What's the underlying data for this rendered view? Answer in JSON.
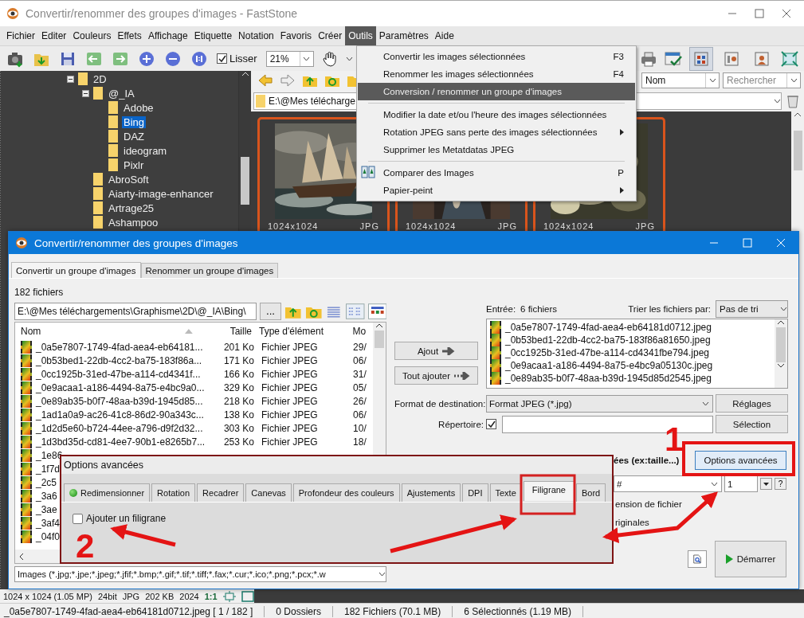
{
  "window": {
    "title": "Convertir/renommer des groupes d'images - FastStone"
  },
  "menubar": [
    {
      "label": "Fichier",
      "selected": false
    },
    {
      "label": "Editer",
      "selected": false
    },
    {
      "label": "Couleurs",
      "selected": false
    },
    {
      "label": "Effets",
      "selected": false
    },
    {
      "label": "Affichage",
      "selected": false
    },
    {
      "label": "Etiquette",
      "selected": false
    },
    {
      "label": "Notation",
      "selected": false
    },
    {
      "label": "Favoris",
      "selected": false
    },
    {
      "label": "Créer",
      "selected": false
    },
    {
      "label": "Outils",
      "selected": true
    },
    {
      "label": "Paramètres",
      "selected": false
    },
    {
      "label": "Aide",
      "selected": false
    }
  ],
  "toolbar": {
    "smooth": {
      "label": "Lisser",
      "checked": true
    },
    "zoom": "21%",
    "view_buttons": [
      {
        "selected": true
      },
      {
        "selected": false
      },
      {
        "selected": false
      }
    ]
  },
  "browser": {
    "sort": "Nom",
    "search_placeholder": "Rechercher",
    "path": "E:\\@Mes télécharge"
  },
  "tree": [
    {
      "label": "2D",
      "selected": false,
      "children": [
        {
          "label": "@_IA",
          "selected": false,
          "children": [
            {
              "label": "Adobe",
              "selected": false
            },
            {
              "label": "Bing",
              "selected": true
            },
            {
              "label": "DAZ",
              "selected": false
            },
            {
              "label": "ideogram",
              "selected": false
            },
            {
              "label": "Pixlr",
              "selected": false
            }
          ]
        },
        {
          "label": "AbroSoft",
          "selected": false
        },
        {
          "label": "Aiarty-image-enhancer",
          "selected": false
        },
        {
          "label": "Artrage25",
          "selected": false
        },
        {
          "label": "Ashampoo",
          "selected": false
        }
      ]
    }
  ],
  "thumbnails": [
    {
      "size": "1024x1024",
      "format": "JPG"
    },
    {
      "size": "1024x1024",
      "format": "JPG"
    },
    {
      "size": "1024x1024",
      "format": "JPG"
    }
  ],
  "tools_menu": [
    {
      "kind": "item",
      "label": "Convertir les images sélectionnées",
      "shortcut": "F3",
      "submenu": false,
      "selected": false
    },
    {
      "kind": "item",
      "label": "Renommer les images sélectionnées",
      "shortcut": "F4",
      "submenu": false,
      "selected": false
    },
    {
      "kind": "item",
      "label": "Conversion / renommer un groupe d'images",
      "submenu": false,
      "selected": true
    },
    {
      "kind": "separator"
    },
    {
      "kind": "item",
      "label": "Modifier la date et/ou l'heure des images sélectionnées",
      "submenu": false,
      "selected": false
    },
    {
      "kind": "item",
      "label": "Rotation JPEG sans perte des images sélectionnées",
      "submenu": true,
      "selected": false
    },
    {
      "kind": "item",
      "label": "Supprimer les Metatdatas JPEG",
      "submenu": false,
      "selected": false
    },
    {
      "kind": "separator"
    },
    {
      "kind": "item",
      "label": "Comparer des Images",
      "shortcut": "P",
      "icon": true,
      "submenu": false,
      "selected": false
    },
    {
      "kind": "item",
      "label": "Papier-peint",
      "submenu": true,
      "selected": false
    }
  ],
  "image_info": {
    "dimensions": "1024 x 1024 (1.05 MP)",
    "depth": "24bit",
    "format": "JPG",
    "size": "202 KB",
    "date": "2024",
    "zoom": "1:1"
  },
  "status_bar": [
    "_0a5e7807-1749-4fad-aea4-eb64181d0712.jpeg [ 1 / 182 ]",
    "0 Dossiers",
    "182 Fichiers (70.1 MB)",
    "6 Sélectionnés (1.19 MB)"
  ],
  "dialog": {
    "title": "Convertir/renommer des groupes d'images",
    "tabs": [
      {
        "label": "Convertir un groupe d'images",
        "selected": true
      },
      {
        "label": "Renommer un groupe d'images",
        "selected": false
      }
    ],
    "file_count": "182 fichiers",
    "folder": "E:\\@Mes téléchargements\\Graphisme\\2D\\@_IA\\Bing\\",
    "browse": "...",
    "columns": [
      "Nom",
      "Taille",
      "Type d'élément",
      "Mo"
    ],
    "files": [
      {
        "name": "_0a5e7807-1749-4fad-aea4-eb64181...",
        "size": "201 Ko",
        "type": "Fichier JPEG",
        "date": "29/"
      },
      {
        "name": "_0b53bed1-22db-4cc2-ba75-183f86a...",
        "size": "171 Ko",
        "type": "Fichier JPEG",
        "date": "06/"
      },
      {
        "name": "_0cc1925b-31ed-47be-a114-cd4341f...",
        "size": "166 Ko",
        "type": "Fichier JPEG",
        "date": "31/"
      },
      {
        "name": "_0e9acaa1-a186-4494-8a75-e4bc9a0...",
        "size": "329 Ko",
        "type": "Fichier JPEG",
        "date": "05/"
      },
      {
        "name": "_0e89ab35-b0f7-48aa-b39d-1945d85...",
        "size": "218 Ko",
        "type": "Fichier JPEG",
        "date": "26/"
      },
      {
        "name": "_1ad1a0a9-ac26-41c8-86d2-90a343c...",
        "size": "138 Ko",
        "type": "Fichier JPEG",
        "date": "06/"
      },
      {
        "name": "_1d2d5e60-b724-44ee-a796-d9f2d32...",
        "size": "303 Ko",
        "type": "Fichier JPEG",
        "date": "10/"
      },
      {
        "name": "_1d3bd35d-cd81-4ee7-90b1-e8265b7...",
        "size": "253 Ko",
        "type": "Fichier JPEG",
        "date": "18/"
      },
      {
        "name": "_1e86"
      },
      {
        "name": "_1f7d"
      },
      {
        "name": "_2c5"
      },
      {
        "name": "_3a6"
      },
      {
        "name": "_3ae"
      },
      {
        "name": "_3af4"
      },
      {
        "name": "_04f0"
      }
    ],
    "filter": "Images (*.jpg;*.jpe;*.jpeg;*.jfif;*.bmp;*.gif;*.tif;*.tiff;*.fax;*.cur;*.ico;*.png;*.pcx;*.w",
    "input_label": "Entrée:",
    "input_count": "6 fichiers",
    "sort_label": "Trier les fichiers par:",
    "sort_value": "Pas de tri",
    "input_files": [
      "_0a5e7807-1749-4fad-aea4-eb64181d0712.jpeg",
      "_0b53bed1-22db-4cc2-ba75-183f86a81650.jpeg",
      "_0cc1925b-31ed-47be-a114-cd4341fbe794.jpeg",
      "_0e9acaa1-a186-4494-8a75-e4bc9a05130c.jpeg",
      "_0e89ab35-b0f7-48aa-b39d-1945d85d2545.jpeg"
    ],
    "add_button": "Ajout",
    "add_all_button": "Tout ajouter",
    "format_label": "Format de destination:",
    "format_value": "Format JPEG (*.jpg)",
    "settings_button": "Réglages",
    "folder_label": "Répertoire:",
    "folder_checked": true,
    "select_button": "Sélection",
    "options_label": "ées (ex:taille...)",
    "options_button": "Options avancées",
    "pattern": "#",
    "start_number": "1",
    "help_button": "?",
    "extension_label": "ension de fichier",
    "originals_label": "riginales",
    "start_button": "Démarrer"
  },
  "advanced": {
    "title": "Options avancées",
    "tabs": [
      {
        "label": "Redimensionner",
        "indicator": true,
        "selected": false
      },
      {
        "label": "Rotation",
        "indicator": false,
        "selected": false
      },
      {
        "label": "Recadrer",
        "indicator": false,
        "selected": false
      },
      {
        "label": "Canevas",
        "indicator": false,
        "selected": false
      },
      {
        "label": "Profondeur des couleurs",
        "indicator": false,
        "selected": false
      },
      {
        "label": "Ajustements",
        "indicator": false,
        "selected": false
      },
      {
        "label": "DPI",
        "indicator": false,
        "selected": false
      },
      {
        "label": "Texte",
        "indicator": false,
        "selected": false
      },
      {
        "label": "Filigrane",
        "indicator": false,
        "selected": true
      },
      {
        "label": "Bord",
        "indicator": false,
        "selected": false
      }
    ],
    "watermark": {
      "label": "Ajouter un filigrane",
      "checked": false
    }
  },
  "annotations": [
    "1",
    "2"
  ]
}
